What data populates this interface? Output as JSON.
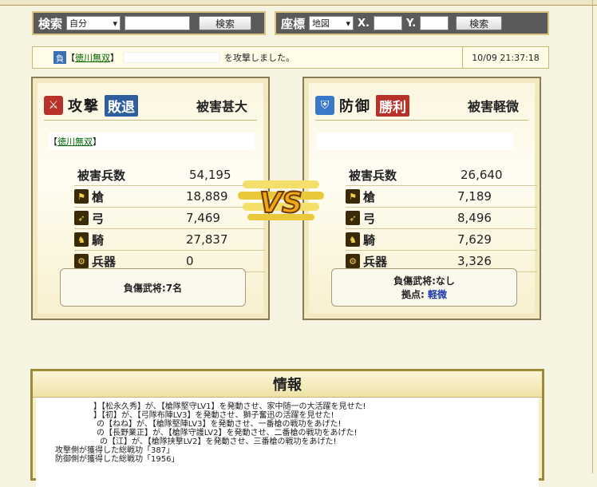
{
  "search_bar": {
    "label": "検索",
    "select_value": "自分",
    "button": "検索"
  },
  "coord_bar": {
    "label": "座標",
    "select_value": "地図",
    "x_label": "X.",
    "y_label": "Y.",
    "button": "検索"
  },
  "news": {
    "badge": "負",
    "bracket_open": "【",
    "who": "徳川無双",
    "bracket_close": "】",
    "text": "を攻撃しました。",
    "time": "10/09 21:37:18"
  },
  "attacker": {
    "role": "攻撃",
    "result": "敗退",
    "damage_label": "被害甚大",
    "name_prefix": "【",
    "name": "徳川無双",
    "name_suffix": "】",
    "losses_label": "被害兵数",
    "losses_total": "54,195",
    "units": [
      {
        "icon": "spear-icon",
        "name": "槍",
        "value": "18,889"
      },
      {
        "icon": "bow-icon",
        "name": "弓",
        "value": "7,469"
      },
      {
        "icon": "horse-icon",
        "name": "騎",
        "value": "27,837"
      },
      {
        "icon": "siege-icon",
        "name": "兵器",
        "value": "0"
      }
    ],
    "injured": "負傷武将:7名",
    "accent": "#c0392b"
  },
  "defender": {
    "role": "防御",
    "result": "勝利",
    "damage_label": "被害軽微",
    "losses_label": "被害兵数",
    "losses_total": "26,640",
    "units": [
      {
        "icon": "spear-icon",
        "name": "槍",
        "value": "7,189"
      },
      {
        "icon": "bow-icon",
        "name": "弓",
        "value": "8,496"
      },
      {
        "icon": "horse-icon",
        "name": "騎",
        "value": "7,629"
      },
      {
        "icon": "siege-icon",
        "name": "兵器",
        "value": "3,326"
      }
    ],
    "injured": "負傷武将:なし",
    "base_label": "拠点:",
    "base_value": "軽微",
    "accent": "#3a78c9"
  },
  "vs_text": "VS",
  "info": {
    "title": "情報",
    "lines": [
      "】【松永久秀】が、【槍隊堅守LV1】を発動させ、家中随一の大活躍を見せた!",
      "】【初】が、【弓隊布陣LV3】を発動させ、獅子奮迅の活躍を見せた!",
      "の【ねね】が、【槍隊堅陣LV3】を発動させ、一番槍の戦功をあげた!",
      "の【長野業正】が、【槍隊守護LV2】を発動させ、二番槍の戦功をあげた!",
      "の【江】が、【槍隊挟撃LV2】を発動させ、三番槍の戦功をあげた!",
      "攻撃側が獲得した総戦功「387」",
      "防御側が獲得した総戦功「1956」"
    ]
  }
}
